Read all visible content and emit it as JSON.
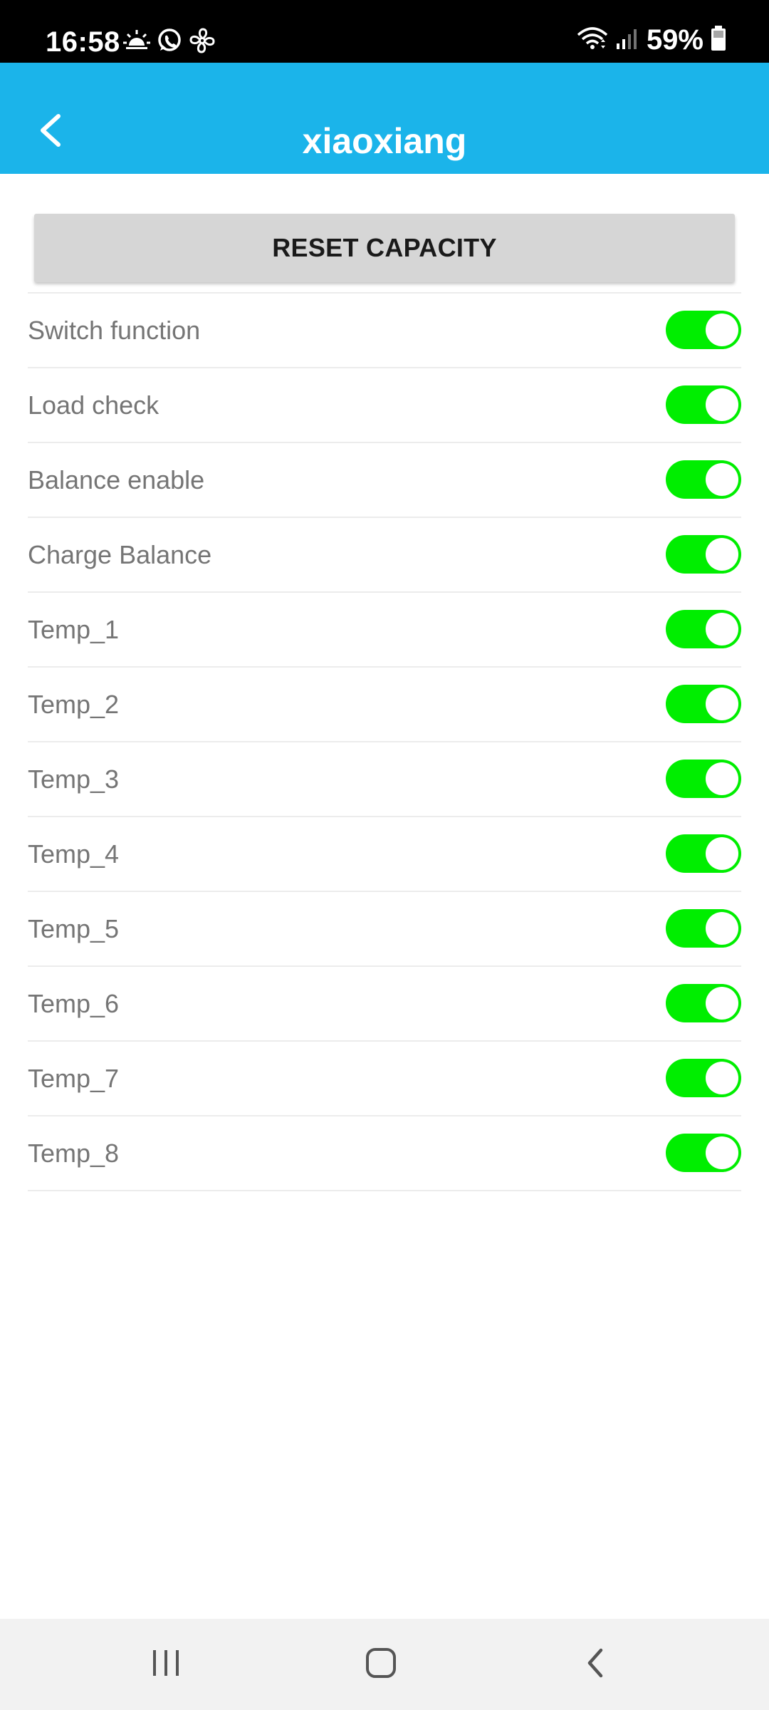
{
  "status_bar": {
    "time": "16:58",
    "battery": "59%",
    "icons": [
      "weather-sunrise-icon",
      "whatsapp-icon",
      "fan-icon",
      "wifi-icon",
      "signal-icon",
      "battery-icon"
    ]
  },
  "app_bar": {
    "title": "xiaoxiang",
    "back_icon": "chevron-left-icon",
    "color": "#1bb4ea"
  },
  "reset_button": {
    "label": "RESET CAPACITY"
  },
  "settings": [
    {
      "label": "Switch function",
      "enabled": true
    },
    {
      "label": "Load check",
      "enabled": true
    },
    {
      "label": "Balance enable",
      "enabled": true
    },
    {
      "label": "Charge Balance",
      "enabled": true
    },
    {
      "label": "Temp_1",
      "enabled": true
    },
    {
      "label": "Temp_2",
      "enabled": true
    },
    {
      "label": "Temp_3",
      "enabled": true
    },
    {
      "label": "Temp_4",
      "enabled": true
    },
    {
      "label": "Temp_5",
      "enabled": true
    },
    {
      "label": "Temp_6",
      "enabled": true
    },
    {
      "label": "Temp_7",
      "enabled": true
    },
    {
      "label": "Temp_8",
      "enabled": true
    }
  ],
  "toggle_on_color": "#00ee00",
  "nav_bar": {
    "items": [
      "recent-apps-icon",
      "home-icon",
      "back-icon"
    ]
  }
}
